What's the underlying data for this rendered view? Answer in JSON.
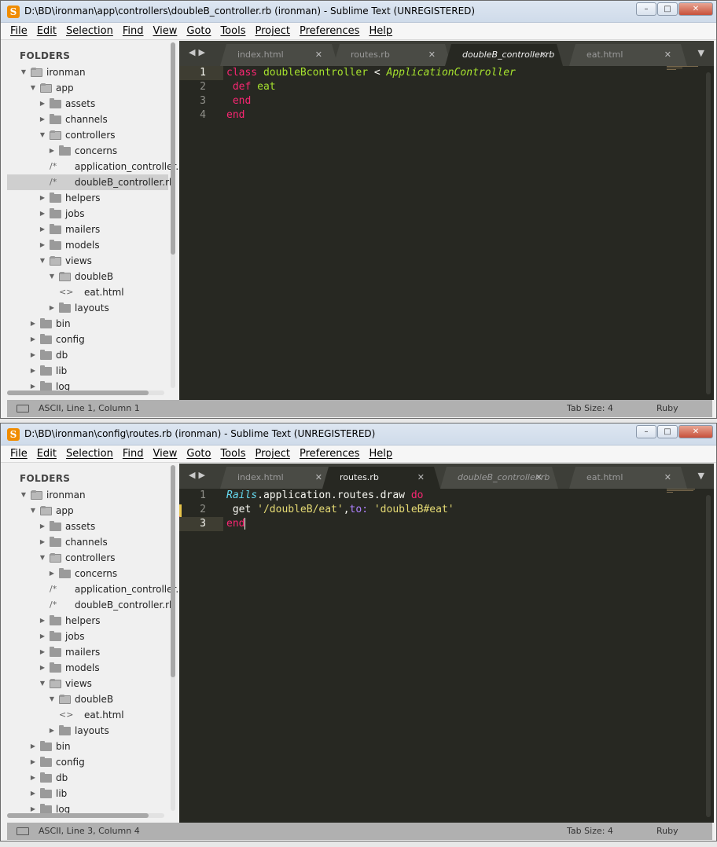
{
  "windows": [
    {
      "title": "D:\\BD\\ironman\\app\\controllers\\doubleB_controller.rb (ironman) - Sublime Text (UNREGISTERED)",
      "tabs": [
        {
          "label": "index.html",
          "active": false
        },
        {
          "label": "routes.rb",
          "active": false
        },
        {
          "label": "doubleB_controller.rb",
          "active": true
        },
        {
          "label": "eat.html",
          "active": false
        }
      ],
      "line_numbers": [
        "1",
        "2",
        "3",
        "4"
      ],
      "current_line": 1,
      "status": {
        "left": "ASCII, Line 1, Column 1",
        "tab_size": "Tab Size: 4",
        "syntax": "Ruby"
      }
    },
    {
      "title": "D:\\BD\\ironman\\config\\routes.rb (ironman) - Sublime Text (UNREGISTERED)",
      "tabs": [
        {
          "label": "index.html",
          "active": false
        },
        {
          "label": "routes.rb",
          "active": true
        },
        {
          "label": "doubleB_controller.rb",
          "active": false
        },
        {
          "label": "eat.html",
          "active": false
        }
      ],
      "line_numbers": [
        "1",
        "2",
        "3"
      ],
      "current_line": 3,
      "status": {
        "left": "ASCII, Line 3, Column 4",
        "tab_size": "Tab Size: 4",
        "syntax": "Ruby"
      }
    }
  ],
  "menu": [
    "File",
    "Edit",
    "Selection",
    "Find",
    "View",
    "Goto",
    "Tools",
    "Project",
    "Preferences",
    "Help"
  ],
  "window_buttons": {
    "minimize": "–",
    "maximize": "□",
    "close": "✕"
  },
  "tab_close_glyph": "✕",
  "sidebar": {
    "heading": "FOLDERS",
    "tree": [
      {
        "label": "ironman",
        "depth": 0,
        "type": "folder",
        "open": true
      },
      {
        "label": "app",
        "depth": 1,
        "type": "folder",
        "open": true
      },
      {
        "label": "assets",
        "depth": 2,
        "type": "folder",
        "open": false
      },
      {
        "label": "channels",
        "depth": 2,
        "type": "folder",
        "open": false
      },
      {
        "label": "controllers",
        "depth": 2,
        "type": "folder",
        "open": true
      },
      {
        "label": "concerns",
        "depth": 3,
        "type": "folder",
        "open": false
      },
      {
        "label": "application_controller.",
        "depth": 3,
        "type": "file",
        "icon": "/*"
      },
      {
        "label": "doubleB_controller.rb",
        "depth": 3,
        "type": "file",
        "icon": "/*"
      },
      {
        "label": "helpers",
        "depth": 2,
        "type": "folder",
        "open": false
      },
      {
        "label": "jobs",
        "depth": 2,
        "type": "folder",
        "open": false
      },
      {
        "label": "mailers",
        "depth": 2,
        "type": "folder",
        "open": false
      },
      {
        "label": "models",
        "depth": 2,
        "type": "folder",
        "open": false
      },
      {
        "label": "views",
        "depth": 2,
        "type": "folder",
        "open": true
      },
      {
        "label": "doubleB",
        "depth": 3,
        "type": "folder",
        "open": true
      },
      {
        "label": "eat.html",
        "depth": 4,
        "type": "file",
        "icon": "<>"
      },
      {
        "label": "layouts",
        "depth": 3,
        "type": "folder",
        "open": false
      },
      {
        "label": "bin",
        "depth": 1,
        "type": "folder",
        "open": false
      },
      {
        "label": "config",
        "depth": 1,
        "type": "folder",
        "open": false
      },
      {
        "label": "db",
        "depth": 1,
        "type": "folder",
        "open": false
      },
      {
        "label": "lib",
        "depth": 1,
        "type": "folder",
        "open": false
      },
      {
        "label": "log",
        "depth": 1,
        "type": "folder",
        "open": false
      }
    ]
  },
  "code1": {
    "l1_kw": "class",
    "l1_name": "doubleBcontroller",
    "l1_op": "<",
    "l1_parent": "ApplicationController",
    "l2_kw": "def",
    "l2_name": "eat",
    "l3_kw": "end",
    "l4_kw": "end"
  },
  "code2": {
    "l1_const": "Rails",
    "l1_rest": ".application.routes.draw",
    "l1_kw": "do",
    "l2_fn": "get",
    "l2_str1": "'/doubleB/eat'",
    "l2_comma": ",",
    "l2_sym": "to:",
    "l2_str2": "'doubleB#eat'",
    "l3_kw": "end"
  },
  "theme": {
    "editor_bg": "#272822",
    "keyword": "#f92672",
    "class": "#a6e22e",
    "string": "#e6db74",
    "symbol": "#ae81ff"
  }
}
